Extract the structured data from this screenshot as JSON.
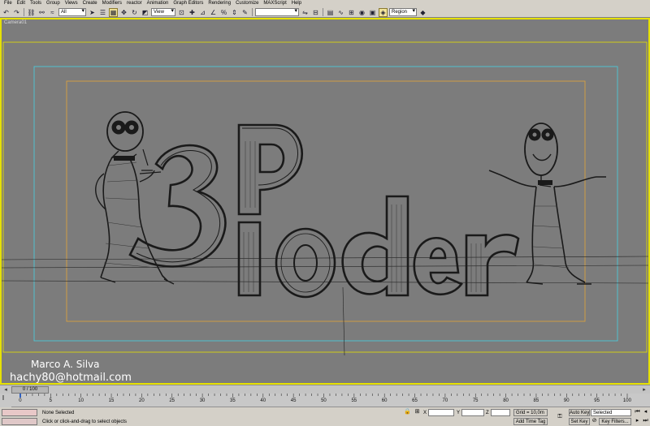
{
  "menu": [
    "File",
    "Edit",
    "Tools",
    "Group",
    "Views",
    "Create",
    "Modifiers",
    "reactor",
    "Animation",
    "Graph Editors",
    "Rendering",
    "Customize",
    "MAXScript",
    "Help"
  ],
  "toolbar": {
    "selection_filter": "All",
    "reference_coord": "View",
    "named_selection": "",
    "region_mode": "Region"
  },
  "viewport": {
    "label": "Camera01",
    "overlay_name": "Marco A. Silva",
    "overlay_email": "hachy80@hotmail.com"
  },
  "time_slider": {
    "position": "0 / 100",
    "current_frame": 0,
    "total_frames": 100
  },
  "track_bar": {
    "tick_labels": [
      "0",
      "5",
      "10",
      "15",
      "20",
      "25",
      "30",
      "35",
      "40",
      "45",
      "50",
      "55",
      "60",
      "65",
      "70",
      "75",
      "80",
      "85",
      "90",
      "95",
      "100"
    ]
  },
  "status": {
    "selection": "None Selected",
    "prompt": "Click or click-and-drag to select objects",
    "x_label": "X",
    "x_value": "",
    "y_label": "Y",
    "y_value": "",
    "z_label": "Z",
    "z_value": "",
    "grid": "Grid = 10,0m",
    "add_time_tag": "Add Time Tag",
    "auto_key": "Auto Key",
    "set_key": "Set Key",
    "key_mode": "Selected",
    "key_filters": "Key Filters..."
  },
  "colors": {
    "viewport_bg": "#7c7c7c",
    "active_border": "#e6e100",
    "safe_frame_outer": "#4cc8d8",
    "safe_frame_inner": "#d8a040"
  }
}
